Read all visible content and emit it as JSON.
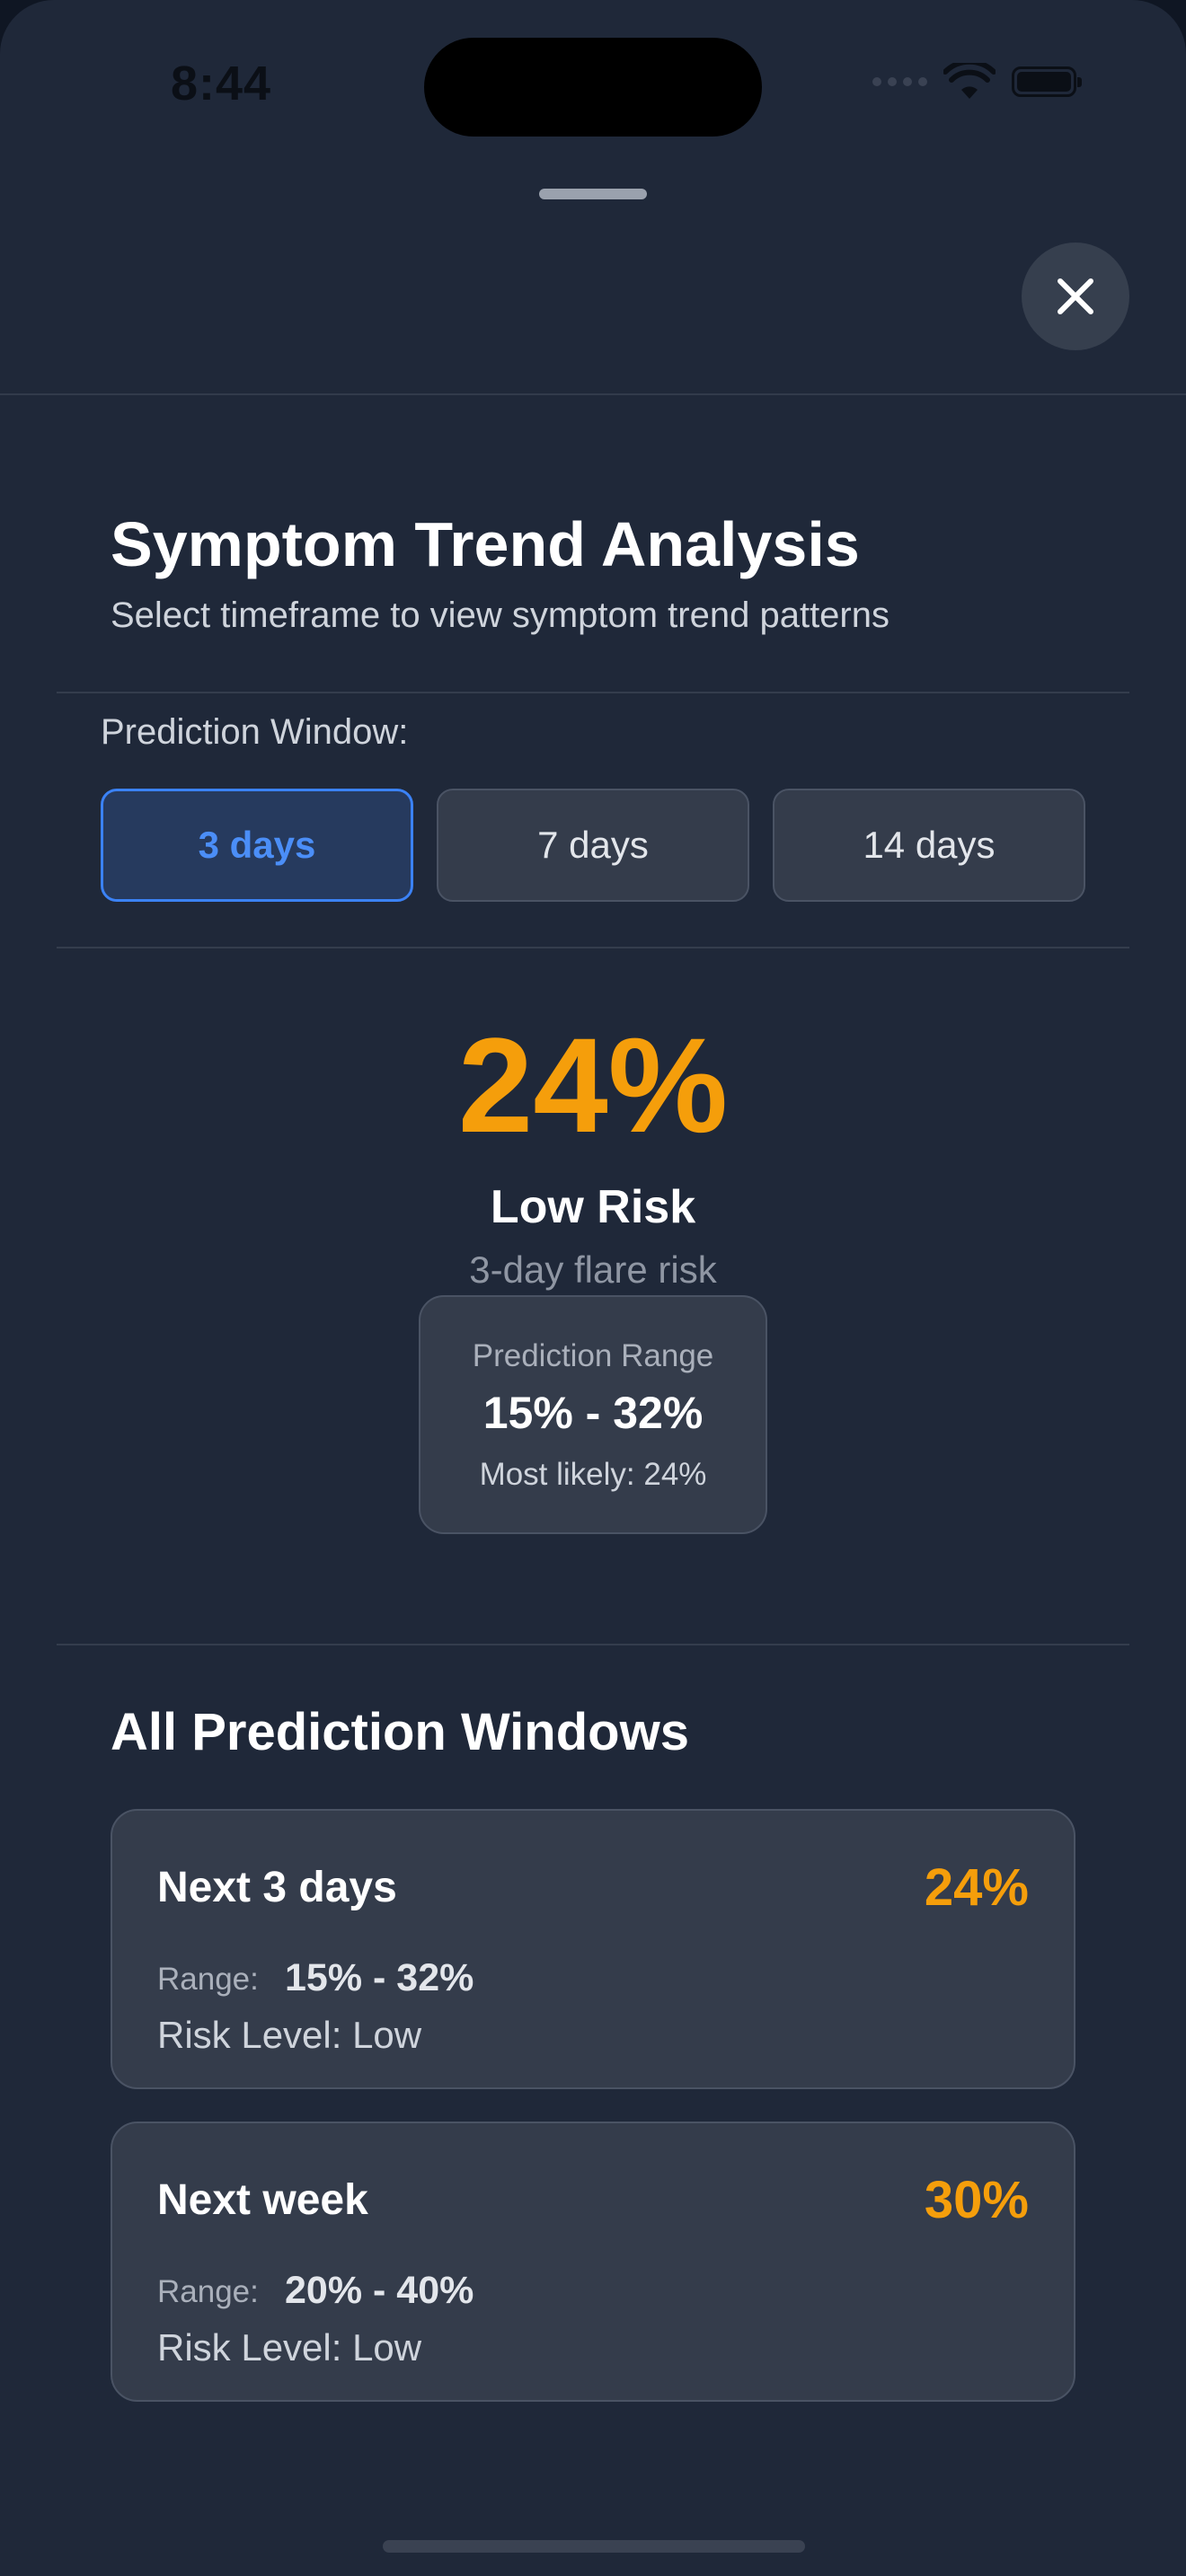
{
  "status_bar": {
    "time": "8:44",
    "icons": [
      "signal-dots-icon",
      "wifi-icon",
      "battery-icon"
    ]
  },
  "header": {
    "close_icon": "close-icon"
  },
  "intro": {
    "title": "Symptom Trend Analysis",
    "subtitle": "Select timeframe to view symptom trend patterns"
  },
  "prediction_window": {
    "label": "Prediction Window:",
    "options": [
      {
        "label": "3 days",
        "selected": true
      },
      {
        "label": "7 days",
        "selected": false
      },
      {
        "label": "14 days",
        "selected": false
      }
    ]
  },
  "summary": {
    "percent": "24%",
    "risk_label": "Low Risk",
    "risk_description": "3-day flare risk",
    "range_label": "Prediction Range",
    "range_value": "15% - 32%",
    "most_likely": "Most likely: 24%"
  },
  "all_windows": {
    "title": "All Prediction Windows",
    "range_label": "Range:",
    "cards": [
      {
        "title": "Next 3 days",
        "percent": "24%",
        "range": "15% - 32%",
        "risk_level": "Risk Level: Low"
      },
      {
        "title": "Next week",
        "percent": "30%",
        "range": "20% - 40%",
        "risk_level": "Risk Level: Low"
      }
    ]
  },
  "colors": {
    "background": "#1f2839",
    "accent_orange": "#f59e0b",
    "accent_blue": "#3b82f6",
    "card": "#343c4b"
  }
}
